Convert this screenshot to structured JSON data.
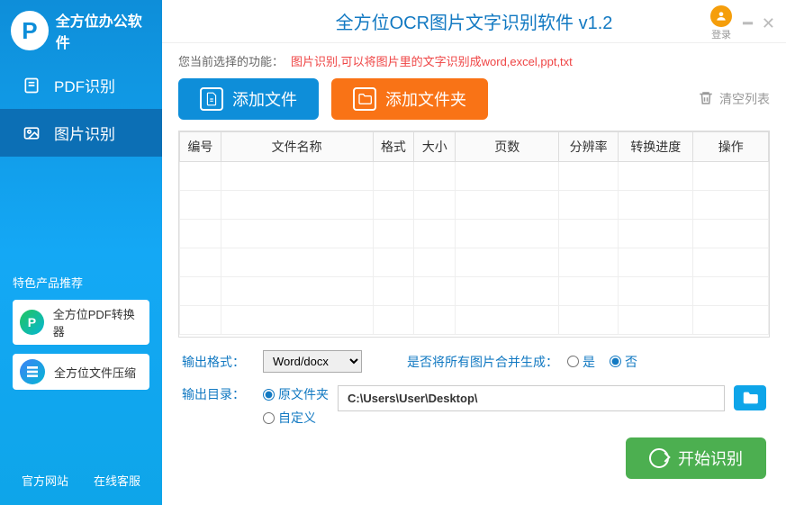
{
  "sidebar": {
    "logo_text": "全方位办公软件",
    "nav": [
      {
        "label": "PDF识别"
      },
      {
        "label": "图片识别"
      }
    ],
    "promo_title": "特色产品推荐",
    "promo_items": [
      {
        "label": "全方位PDF转换器"
      },
      {
        "label": "全方位文件压缩"
      }
    ],
    "footer": {
      "official": "官方网站",
      "support": "在线客服"
    }
  },
  "titlebar": {
    "title": "全方位OCR图片文字识别软件 v1.2",
    "login": "登录"
  },
  "func": {
    "label": "您当前选择的功能：",
    "desc": "图片识别,可以将图片里的文字识别成word,excel,ppt,txt"
  },
  "actions": {
    "add_file": "添加文件",
    "add_folder": "添加文件夹",
    "clear": "清空列表"
  },
  "table": {
    "headers": [
      "编号",
      "文件名称",
      "格式",
      "大小",
      "页数",
      "分辨率",
      "转换进度",
      "操作"
    ]
  },
  "output": {
    "format_label": "输出格式：",
    "format_value": "Word/docx",
    "merge_q": "是否将所有图片合并生成：",
    "opt_yes": "是",
    "opt_no": "否",
    "dir_label": "输出目录：",
    "dir_original": "原文件夹",
    "dir_custom": "自定义",
    "path_value": "C:\\Users\\User\\Desktop\\"
  },
  "start": {
    "label": "开始识别"
  }
}
